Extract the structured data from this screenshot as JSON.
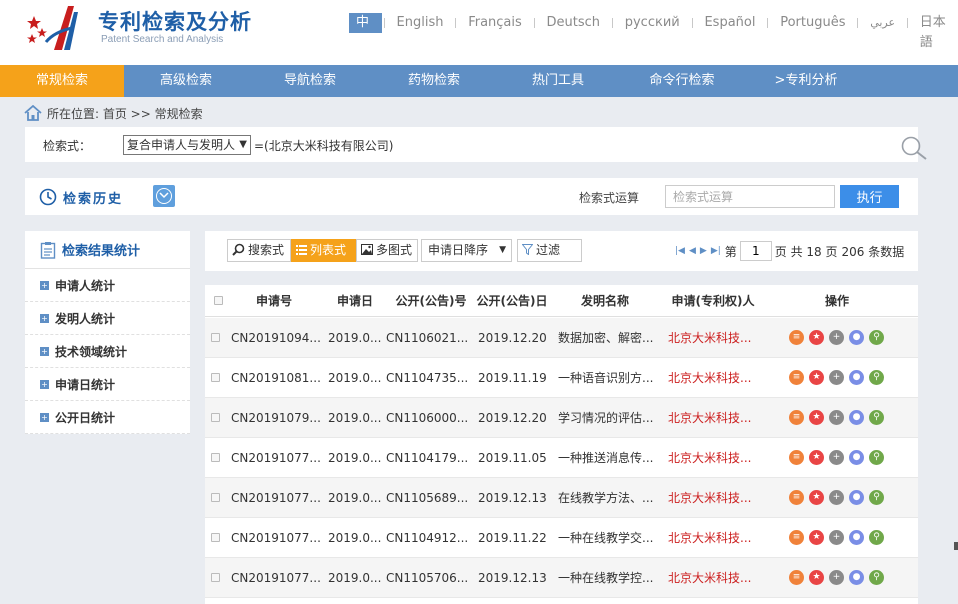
{
  "header": {
    "title": "专利检索及分析",
    "subtitle": "Patent Search and Analysis",
    "languages": [
      "中文",
      "English",
      "Français",
      "Deutsch",
      "русский",
      "Español",
      "Português",
      "عربي",
      "日本語"
    ]
  },
  "nav": {
    "items": [
      "常规检索",
      "高级检索",
      "导航检索",
      "药物检索",
      "热门工具",
      "命令行检索",
      ">专利分析"
    ]
  },
  "breadcrumb": {
    "text": "所在位置: 首页 >> 常规检索"
  },
  "search": {
    "label": "检索式：",
    "field": "复合申请人与发明人",
    "expression": "=(北京大米科技有限公司)"
  },
  "history": {
    "title": "检索历史",
    "op_label": "检索式运算",
    "op_placeholder": "检索式运算",
    "exec_label": "执行"
  },
  "stats": {
    "title": "检索结果统计",
    "items": [
      "申请人统计",
      "发明人统计",
      "技术领域统计",
      "申请日统计",
      "公开日统计"
    ]
  },
  "toolbar": {
    "expr_view": "搜索式",
    "list_view": "列表式",
    "multi_view": "多图式",
    "sort": "申请日降序",
    "filter": "过滤",
    "pager": {
      "prefix": "第",
      "page": "1",
      "total_pages": "页 共 18 页",
      "total_records": "206 条数据"
    }
  },
  "table": {
    "headers": [
      "申请号",
      "申请日",
      "公开(公告)号",
      "公开(公告)日",
      "发明名称",
      "申请(专利权)人",
      "操作"
    ],
    "rows": [
      {
        "app_no": "CN20191094...",
        "app_date": "2019.0...",
        "pub_no": "CN1106021...",
        "pub_date": "2019.12.20",
        "title": "数据加密、解密...",
        "applicant": "北京大米科技..."
      },
      {
        "app_no": "CN20191081...",
        "app_date": "2019.0...",
        "pub_no": "CN1104735...",
        "pub_date": "2019.11.19",
        "title": "一种语音识别方...",
        "applicant": "北京大米科技..."
      },
      {
        "app_no": "CN20191079...",
        "app_date": "2019.0...",
        "pub_no": "CN1106000...",
        "pub_date": "2019.12.20",
        "title": "学习情况的评估...",
        "applicant": "北京大米科技..."
      },
      {
        "app_no": "CN20191077...",
        "app_date": "2019.0...",
        "pub_no": "CN1104179...",
        "pub_date": "2019.11.05",
        "title": "一种推送消息传...",
        "applicant": "北京大米科技..."
      },
      {
        "app_no": "CN20191077...",
        "app_date": "2019.0...",
        "pub_no": "CN1105689...",
        "pub_date": "2019.12.13",
        "title": "在线教学方法、...",
        "applicant": "北京大米科技..."
      },
      {
        "app_no": "CN20191077...",
        "app_date": "2019.0...",
        "pub_no": "CN1104912...",
        "pub_date": "2019.11.22",
        "title": "一种在线教学交...",
        "applicant": "北京大米科技..."
      },
      {
        "app_no": "CN20191077...",
        "app_date": "2019.0...",
        "pub_no": "CN1105706...",
        "pub_date": "2019.12.13",
        "title": "一种在线教学控...",
        "applicant": "北京大米科技..."
      }
    ],
    "op_icons": [
      "list-icon",
      "star-icon",
      "plus-icon",
      "user-icon",
      "search-icon"
    ]
  },
  "colors": {
    "nav_bg": "#5f8fc5",
    "nav_active": "#f5a21a",
    "brand": "#1f5fa7",
    "applicant_text": "#cc1f1f",
    "exec_button": "#3c8ee8"
  }
}
